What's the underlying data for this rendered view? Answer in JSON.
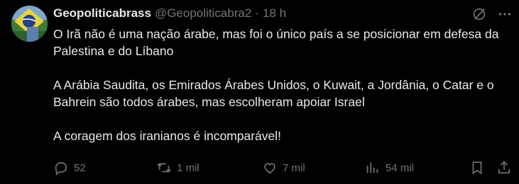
{
  "author": {
    "display_name": "Geopoliticabrass",
    "handle": "@Geopoliticabra2",
    "separator": "·",
    "timestamp": "18 h"
  },
  "tweet": {
    "paragraphs": [
      "O Irã não é uma nação árabe, mas foi o único país a se posicionar em defesa da Palestina e do Líbano",
      "A Arábia Saudita, os Emirados Árabes Unidos, o Kuwait, a Jordânia, o Catar e o Bahrein são todos árabes, mas escolheram apoiar Israel",
      "A coragem dos iranianos é incomparável!"
    ]
  },
  "actions": {
    "replies": "52",
    "reposts": "1 mil",
    "likes": "7 mil",
    "views": "54 mil"
  },
  "icons": {
    "top": [
      "grok-icon",
      "more-icon"
    ],
    "actions": [
      "reply-icon",
      "repost-icon",
      "like-icon",
      "views-icon",
      "bookmark-icon",
      "share-icon"
    ]
  },
  "colors": {
    "background": "#000000",
    "text": "#e7e9ea",
    "muted": "#71767b"
  }
}
